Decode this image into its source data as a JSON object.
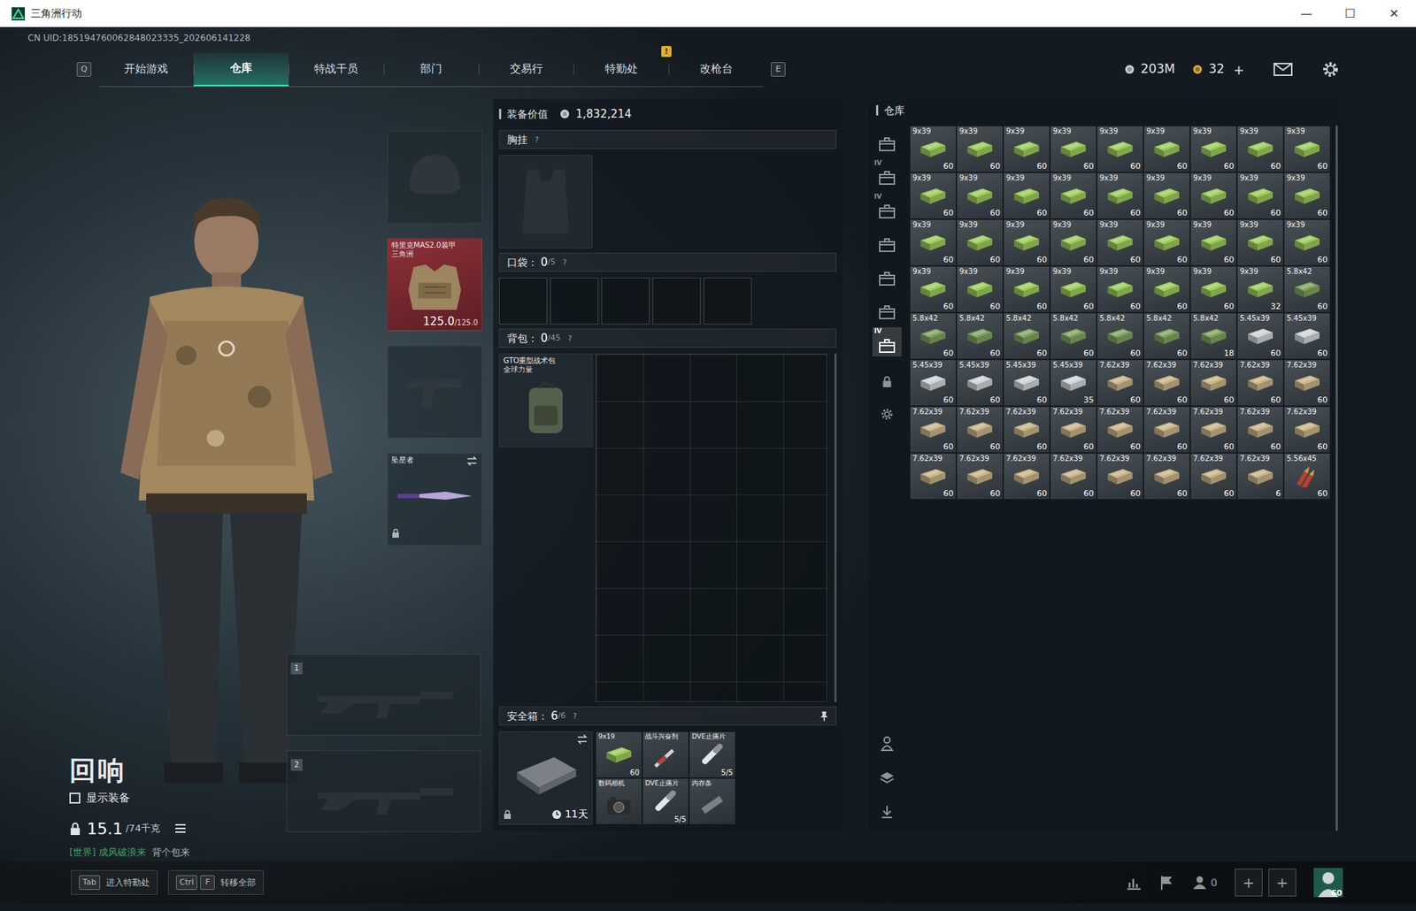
{
  "window": {
    "title": "三角洲行动",
    "controls": [
      "—",
      "☐",
      "✕"
    ]
  },
  "uid": "CN UID:185194760062848023335_202606141228",
  "nav": {
    "prev_key": "Q",
    "next_key": "E",
    "tabs": [
      {
        "label": "开始游戏",
        "selected": false
      },
      {
        "label": "仓库",
        "selected": true
      },
      {
        "label": "特战干员",
        "selected": false
      },
      {
        "label": "部门",
        "selected": false
      },
      {
        "label": "交易行",
        "selected": false
      },
      {
        "label": "特勤处",
        "selected": false,
        "badge": "!"
      },
      {
        "label": "改枪台",
        "selected": false
      }
    ]
  },
  "currency": {
    "coins": "203M",
    "tickets": "32",
    "add": "+"
  },
  "character": {
    "name": "回响",
    "show_gear": {
      "label": "显示装备",
      "checked": false
    },
    "weight": "15.1",
    "weight_limit": "/74千克"
  },
  "chat": {
    "channel": "[世界]",
    "sender": "成风破浪来",
    "message": "背个包来"
  },
  "gear": {
    "helmet": {
      "empty": true
    },
    "armor": {
      "name": "特里克MAS2.0装甲",
      "sub": "三角洲",
      "durability": "125.0",
      "max": "/125.0"
    },
    "pistol": {
      "empty": true
    },
    "melee": {
      "name": "坠星者",
      "locked": true
    }
  },
  "weapon_slots": [
    {
      "number": "1",
      "empty": true
    },
    {
      "number": "2",
      "empty": true
    }
  ],
  "equipment_value": {
    "label": "装备价值",
    "value": "1,832,214"
  },
  "chest_rig": {
    "label": "胸挂",
    "help": "?",
    "empty": true
  },
  "pocket": {
    "label": "口袋：",
    "count": "0",
    "capacity": "/5",
    "help": "?",
    "slots": [
      {
        "filled": false
      },
      {
        "filled": false
      },
      {
        "filled": false
      },
      {
        "filled": false
      },
      {
        "filled": false
      }
    ]
  },
  "backpack": {
    "label": "背包：",
    "count": "0",
    "capacity": "/45",
    "help": "?",
    "item": {
      "name": "GTO重型战术包",
      "sub": "全球力量"
    }
  },
  "safe_box": {
    "label": "安全箱：",
    "count": "6",
    "capacity": "/6",
    "help": "?",
    "pinned": true,
    "case": {
      "time": "11天",
      "locked": true
    },
    "items": [
      {
        "name": "9x19",
        "count": "60",
        "kind": "box",
        "color": "#9ccc5a"
      },
      {
        "name": "战斗兴奋剂",
        "kind": "syringe"
      },
      {
        "name": "DVE止痛片",
        "count": "5/5",
        "kind": "pills"
      },
      {
        "name": "数码相机",
        "kind": "camera"
      },
      {
        "name": "DVE止痛片",
        "count": "5/5",
        "kind": "pills"
      },
      {
        "name": "内存条",
        "kind": "ram"
      }
    ]
  },
  "warehouse": {
    "title": "仓库",
    "tabs": [
      {
        "label": "",
        "selected": false,
        "kind": "crate"
      },
      {
        "label": "IV",
        "selected": false,
        "kind": "crate"
      },
      {
        "label": "IV",
        "selected": false,
        "kind": "crate"
      },
      {
        "label": "",
        "selected": false,
        "kind": "crate"
      },
      {
        "label": "",
        "selected": false,
        "kind": "crate"
      },
      {
        "label": "",
        "selected": false,
        "kind": "crate"
      },
      {
        "label": "IV",
        "selected": true,
        "kind": "crate"
      },
      {
        "label": "",
        "selected": false,
        "kind": "lock"
      },
      {
        "label": "",
        "selected": false,
        "kind": "settings"
      }
    ],
    "tools": [
      {
        "kind": "hanger"
      },
      {
        "kind": "stack"
      },
      {
        "kind": "extract"
      }
    ],
    "items": [
      {
        "label": "9x39",
        "count": "60",
        "color": "#9ccc5a",
        "kind": "box"
      },
      {
        "label": "9x39",
        "count": "60",
        "color": "#9ccc5a",
        "kind": "box"
      },
      {
        "label": "9x39",
        "count": "60",
        "color": "#9ccc5a",
        "kind": "box"
      },
      {
        "label": "9x39",
        "count": "60",
        "color": "#9ccc5a",
        "kind": "box"
      },
      {
        "label": "9x39",
        "count": "60",
        "color": "#9ccc5a",
        "kind": "box"
      },
      {
        "label": "9x39",
        "count": "60",
        "color": "#9ccc5a",
        "kind": "box"
      },
      {
        "label": "9x39",
        "count": "60",
        "color": "#9ccc5a",
        "kind": "box"
      },
      {
        "label": "9x39",
        "count": "60",
        "color": "#9ccc5a",
        "kind": "box"
      },
      {
        "label": "9x39",
        "count": "60",
        "color": "#9ccc5a",
        "kind": "box"
      },
      {
        "label": "9x39",
        "count": "60",
        "color": "#9ccc5a",
        "kind": "box"
      },
      {
        "label": "9x39",
        "count": "60",
        "color": "#9ccc5a",
        "kind": "box"
      },
      {
        "label": "9x39",
        "count": "60",
        "color": "#9ccc5a",
        "kind": "box"
      },
      {
        "label": "9x39",
        "count": "60",
        "color": "#9ccc5a",
        "kind": "box"
      },
      {
        "label": "9x39",
        "count": "60",
        "color": "#9ccc5a",
        "kind": "box"
      },
      {
        "label": "9x39",
        "count": "60",
        "color": "#9ccc5a",
        "kind": "box"
      },
      {
        "label": "9x39",
        "count": "60",
        "color": "#9ccc5a",
        "kind": "box"
      },
      {
        "label": "9x39",
        "count": "60",
        "color": "#9ccc5a",
        "kind": "box"
      },
      {
        "label": "9x39",
        "count": "60",
        "color": "#9ccc5a",
        "kind": "box"
      },
      {
        "label": "9x39",
        "count": "60",
        "color": "#9ccc5a",
        "kind": "box"
      },
      {
        "label": "9x39",
        "count": "60",
        "color": "#9ccc5a",
        "kind": "box"
      },
      {
        "label": "9x39",
        "count": "60",
        "color": "#9ccc5a",
        "kind": "box"
      },
      {
        "label": "9x39",
        "count": "60",
        "color": "#9ccc5a",
        "kind": "box"
      },
      {
        "label": "9x39",
        "count": "60",
        "color": "#9ccc5a",
        "kind": "box"
      },
      {
        "label": "9x39",
        "count": "60",
        "color": "#9ccc5a",
        "kind": "box"
      },
      {
        "label": "9x39",
        "count": "60",
        "color": "#9ccc5a",
        "kind": "box"
      },
      {
        "label": "9x39",
        "count": "60",
        "color": "#9ccc5a",
        "kind": "box"
      },
      {
        "label": "9x39",
        "count": "60",
        "color": "#9ccc5a",
        "kind": "box"
      },
      {
        "label": "9x39",
        "count": "60",
        "color": "#9ccc5a",
        "kind": "box"
      },
      {
        "label": "9x39",
        "count": "60",
        "color": "#9ccc5a",
        "kind": "box"
      },
      {
        "label": "9x39",
        "count": "60",
        "color": "#9ccc5a",
        "kind": "box"
      },
      {
        "label": "9x39",
        "count": "60",
        "color": "#9ccc5a",
        "kind": "box"
      },
      {
        "label": "9x39",
        "count": "60",
        "color": "#9ccc5a",
        "kind": "box"
      },
      {
        "label": "9x39",
        "count": "60",
        "color": "#9ccc5a",
        "kind": "box"
      },
      {
        "label": "9x39",
        "count": "60",
        "color": "#9ccc5a",
        "kind": "box"
      },
      {
        "label": "9x39",
        "count": "32",
        "color": "#9ccc5a",
        "kind": "box"
      },
      {
        "label": "5.8x42",
        "count": "60",
        "color": "#7fa35e",
        "kind": "box"
      },
      {
        "label": "5.8x42",
        "count": "60",
        "color": "#7fa35e",
        "kind": "box"
      },
      {
        "label": "5.8x42",
        "count": "60",
        "color": "#7fa35e",
        "kind": "box"
      },
      {
        "label": "5.8x42",
        "count": "60",
        "color": "#7fa35e",
        "kind": "box"
      },
      {
        "label": "5.8x42",
        "count": "60",
        "color": "#7fa35e",
        "kind": "box"
      },
      {
        "label": "5.8x42",
        "count": "60",
        "color": "#7fa35e",
        "kind": "box"
      },
      {
        "label": "5.8x42",
        "count": "60",
        "color": "#7fa35e",
        "kind": "box"
      },
      {
        "label": "5.8x42",
        "count": "18",
        "color": "#7fa35e",
        "kind": "box"
      },
      {
        "label": "5.45x39",
        "count": "60",
        "color": "#cfd3d6",
        "kind": "box"
      },
      {
        "label": "5.45x39",
        "count": "60",
        "color": "#cfd3d6",
        "kind": "box"
      },
      {
        "label": "5.45x39",
        "count": "60",
        "color": "#cfd3d6",
        "kind": "box"
      },
      {
        "label": "5.45x39",
        "count": "60",
        "color": "#cfd3d6",
        "kind": "box"
      },
      {
        "label": "5.45x39",
        "count": "60",
        "color": "#cfd3d6",
        "kind": "box"
      },
      {
        "label": "5.45x39",
        "count": "35",
        "color": "#cfd3d6",
        "kind": "box"
      },
      {
        "label": "7.62x39",
        "count": "60",
        "color": "#c9b487",
        "kind": "box"
      },
      {
        "label": "7.62x39",
        "count": "60",
        "color": "#c9b487",
        "kind": "box"
      },
      {
        "label": "7.62x39",
        "count": "60",
        "color": "#c9b487",
        "kind": "box"
      },
      {
        "label": "7.62x39",
        "count": "60",
        "color": "#c9b487",
        "kind": "box"
      },
      {
        "label": "7.62x39",
        "count": "60",
        "color": "#c9b487",
        "kind": "box"
      },
      {
        "label": "7.62x39",
        "count": "60",
        "color": "#c9b487",
        "kind": "box"
      },
      {
        "label": "7.62x39",
        "count": "60",
        "color": "#c9b487",
        "kind": "box"
      },
      {
        "label": "7.62x39",
        "count": "60",
        "color": "#c9b487",
        "kind": "box"
      },
      {
        "label": "7.62x39",
        "count": "60",
        "color": "#c9b487",
        "kind": "box"
      },
      {
        "label": "7.62x39",
        "count": "60",
        "color": "#c9b487",
        "kind": "box"
      },
      {
        "label": "7.62x39",
        "count": "60",
        "color": "#c9b487",
        "kind": "box"
      },
      {
        "label": "7.62x39",
        "count": "60",
        "color": "#c9b487",
        "kind": "box"
      },
      {
        "label": "7.62x39",
        "count": "60",
        "color": "#c9b487",
        "kind": "box"
      },
      {
        "label": "7.62x39",
        "count": "60",
        "color": "#c9b487",
        "kind": "box"
      },
      {
        "label": "7.62x39",
        "count": "60",
        "color": "#c9b487",
        "kind": "box"
      },
      {
        "label": "7.62x39",
        "count": "60",
        "color": "#c9b487",
        "kind": "box"
      },
      {
        "label": "7.62x39",
        "count": "60",
        "color": "#c9b487",
        "kind": "box"
      },
      {
        "label": "7.62x39",
        "count": "60",
        "color": "#c9b487",
        "kind": "box"
      },
      {
        "label": "7.62x39",
        "count": "60",
        "color": "#c9b487",
        "kind": "box"
      },
      {
        "label": "7.62x39",
        "count": "60",
        "color": "#c9b487",
        "kind": "box"
      },
      {
        "label": "7.62x39",
        "count": "60",
        "color": "#c9b487",
        "kind": "box"
      },
      {
        "label": "7.62x39",
        "count": "6",
        "color": "#c9b487",
        "kind": "box"
      },
      {
        "label": "5.56x45",
        "count": "60",
        "color": "#b8402f",
        "kind": "round"
      }
    ]
  },
  "bottom_bar": {
    "hints": [
      {
        "keys": [
          "Tab"
        ],
        "label": "进入特勤处"
      },
      {
        "keys": [
          "Ctrl",
          "F"
        ],
        "label": "转移全部"
      }
    ],
    "friends": "0",
    "slots": [
      "+",
      "+"
    ],
    "level": "60"
  }
}
